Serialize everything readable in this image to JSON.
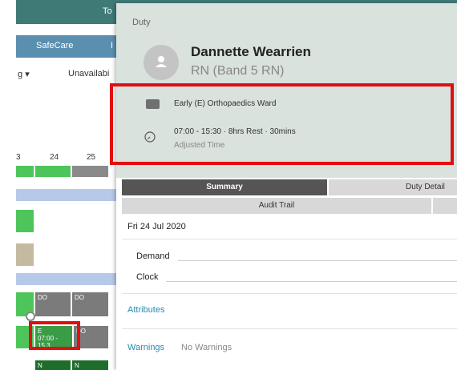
{
  "app": {
    "topbar_text": "To",
    "tab_safecare": "SafeCare",
    "tab_edge": "I",
    "filter_ng": "g",
    "filter_unavailable": "Unavailabi",
    "date_numbers": [
      "3",
      "24",
      "25"
    ],
    "cells": {
      "do1": "DO",
      "do2": "DO",
      "e_label": "E",
      "e_time": "07:00 - 15.3",
      "do3": "DO",
      "n1": "N",
      "n2": "N"
    }
  },
  "panel": {
    "duty_label": "Duty",
    "name": "Dannette Wearrien",
    "role": "RN (Band 5 RN)",
    "ward": "Early (E) Orthopaedics Ward",
    "time": "07:00 - 15:30 · 8hrs  Rest · 30mins",
    "adjusted": "Adjusted Time",
    "tabs": {
      "summary": "Summary",
      "duty_details": "Duty Detail",
      "audit_trail": "Audit Trail"
    },
    "date": "Fri 24 Jul 2020",
    "demand_label": "Demand",
    "clock_label": "Clock",
    "attributes_label": "Attributes",
    "warnings_label": "Warnings",
    "warnings_value": "No Warnings"
  },
  "colors": {
    "highlight": "#e01010",
    "panel_header": "#d9e2dd",
    "link": "#2b8ab0"
  }
}
